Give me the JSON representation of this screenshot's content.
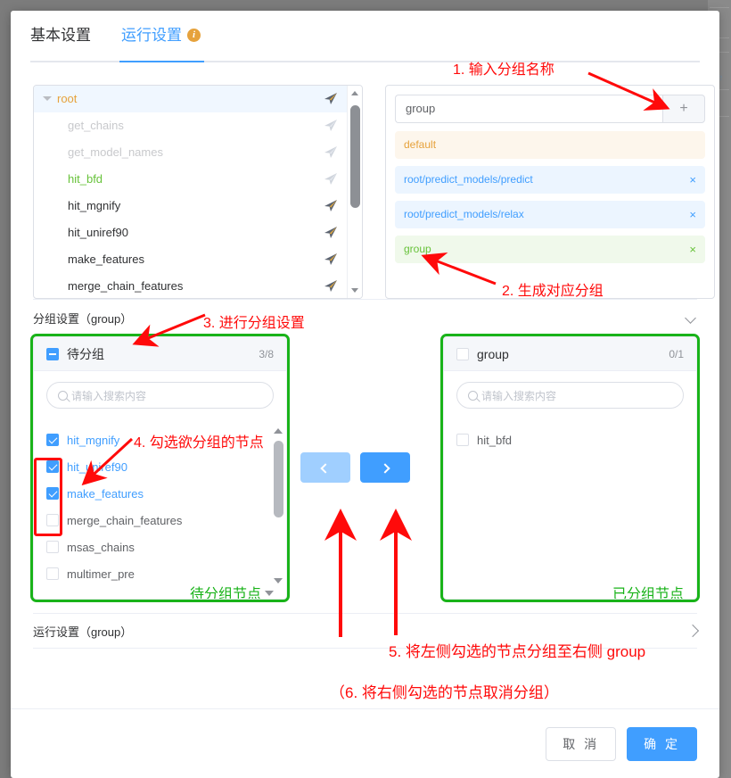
{
  "tabs": [
    {
      "label": "基本设置",
      "active": false
    },
    {
      "label": "运行设置",
      "active": true,
      "info_icon": "info-icon"
    }
  ],
  "tree": {
    "nodes": [
      {
        "label": "root",
        "color": "orange",
        "level": 0,
        "expanded": true,
        "icon": "send-icon",
        "icon_state": "active",
        "selected": true
      },
      {
        "label": "get_chains",
        "color": "gray",
        "level": 1,
        "icon": "send-icon",
        "icon_state": "muted"
      },
      {
        "label": "get_model_names",
        "color": "gray",
        "level": 1,
        "icon": "send-icon",
        "icon_state": "muted"
      },
      {
        "label": "hit_bfd",
        "color": "green",
        "level": 1,
        "icon": "send-icon",
        "icon_state": "muted"
      },
      {
        "label": "hit_mgnify",
        "color": "dark",
        "level": 1,
        "icon": "send-icon",
        "icon_state": "active"
      },
      {
        "label": "hit_uniref90",
        "color": "dark",
        "level": 1,
        "icon": "send-icon",
        "icon_state": "active"
      },
      {
        "label": "make_features",
        "color": "dark",
        "level": 1,
        "icon": "send-icon",
        "icon_state": "active"
      },
      {
        "label": "merge_chain_features",
        "color": "dark",
        "level": 1,
        "icon": "send-icon",
        "icon_state": "active"
      }
    ],
    "scrollbar": {
      "up_icon": "caret-up-icon",
      "down_icon": "caret-down-icon"
    }
  },
  "groups": {
    "input_value": "group",
    "input_placeholder": "",
    "add_label": "+",
    "add_icon": "plus-icon",
    "items": [
      {
        "label": "default",
        "style": "default",
        "removable": false
      },
      {
        "label": "root/predict_models/predict",
        "style": "blue",
        "removable": true,
        "remove_icon": "close-icon"
      },
      {
        "label": "root/predict_models/relax",
        "style": "blue",
        "removable": true,
        "remove_icon": "close-icon"
      },
      {
        "label": "group",
        "style": "green",
        "removable": true,
        "remove_icon": "close-icon"
      }
    ]
  },
  "group_section": {
    "title": "分组设置（group）",
    "collapse_icon": "chevron-down-icon"
  },
  "transfer": {
    "left": {
      "header_label": "待分组",
      "count": "3/8",
      "checkbox_state": "indeterminate",
      "search_placeholder": "请输入搜索内容",
      "search_icon": "search-icon",
      "footer_label": "待分组节点",
      "footer_icon": "caret-down-icon",
      "items": [
        {
          "label": "hit_mgnify",
          "checked": true
        },
        {
          "label": "hit_uniref90",
          "checked": true
        },
        {
          "label": "make_features",
          "checked": true
        },
        {
          "label": "merge_chain_features",
          "checked": false
        },
        {
          "label": "msas_chains",
          "checked": false
        },
        {
          "label": "multimer_pre",
          "checked": false
        }
      ]
    },
    "right": {
      "header_label": "group",
      "count": "0/1",
      "checkbox_state": "unchecked",
      "search_placeholder": "请输入搜索内容",
      "search_icon": "search-icon",
      "footer_label": "已分组节点",
      "items": [
        {
          "label": "hit_bfd",
          "checked": false
        }
      ]
    },
    "buttons": {
      "to_left": {
        "icon": "chevron-left-icon",
        "enabled": false
      },
      "to_right": {
        "icon": "chevron-right-icon",
        "enabled": true
      }
    }
  },
  "run_section": {
    "title": "运行设置（group）",
    "collapse_icon": "chevron-right-icon"
  },
  "footer": {
    "cancel_label": "取 消",
    "confirm_label": "确 定"
  },
  "annotations": [
    {
      "id": "a1",
      "text": "1. 输入分组名称"
    },
    {
      "id": "a2",
      "text": "2. 生成对应分组"
    },
    {
      "id": "a3",
      "text": "3. 进行分组设置"
    },
    {
      "id": "a4",
      "text": "4. 勾选欲分组的节点"
    },
    {
      "id": "a5",
      "text": "5. 将左侧勾选的节点分组至右侧 group"
    },
    {
      "id": "a6",
      "text": "（6. 将右侧勾选的节点取消分组）"
    }
  ],
  "colors": {
    "accent_blue": "#409EFF",
    "warning_orange": "#E6A23C",
    "success_green": "#67C23A",
    "annotation_red": "#FF0A0A",
    "highlight_green_border": "#19B319"
  }
}
